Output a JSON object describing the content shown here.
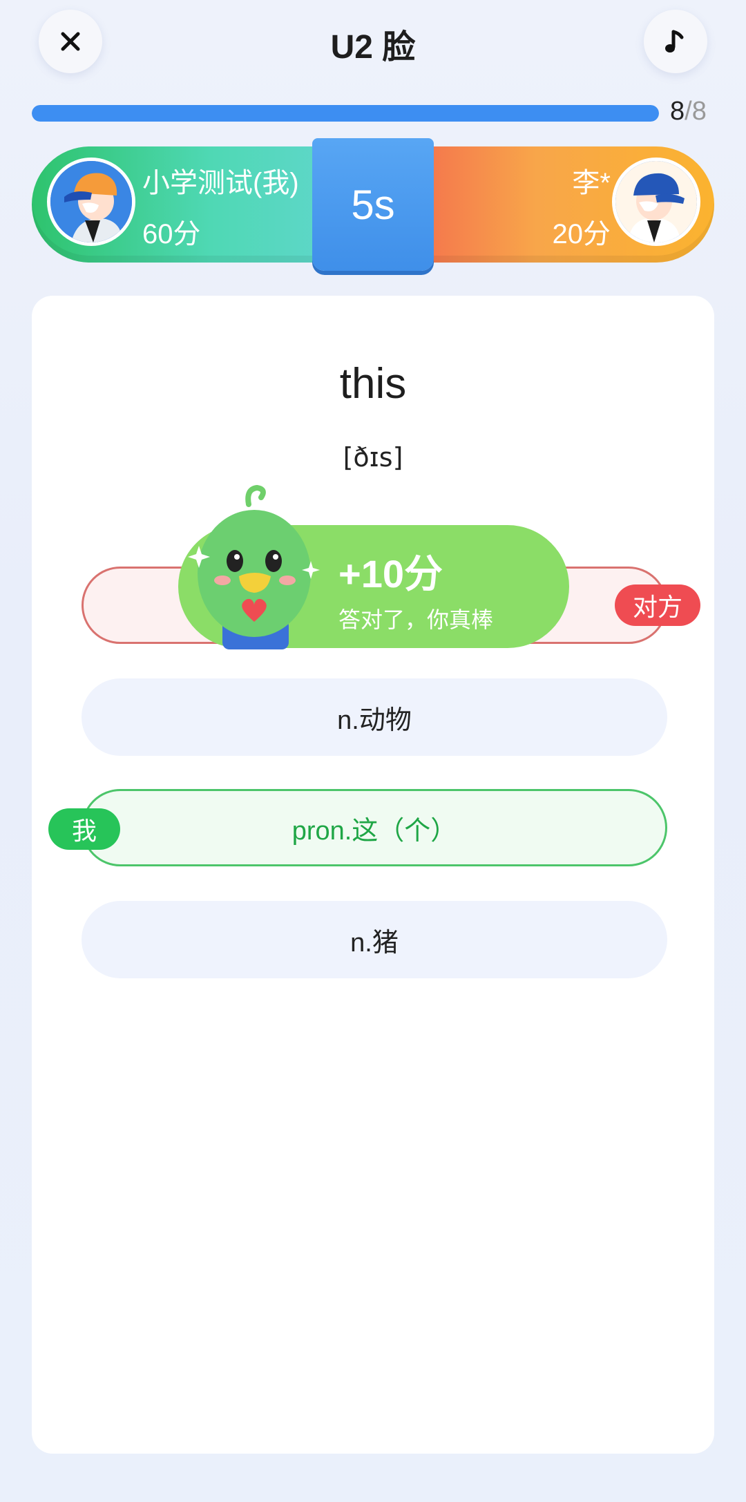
{
  "header": {
    "title": "U2 脸",
    "close_icon": "close-icon",
    "music_icon": "music-note-icon"
  },
  "progress": {
    "current": "8",
    "separator": "/",
    "total": "8",
    "fraction": 1.0
  },
  "battle": {
    "left_player": {
      "name": "小学测试(我)",
      "score": "60分",
      "avatar": "avatar-icon"
    },
    "right_player": {
      "name": "李*",
      "score": "20分",
      "avatar": "avatar-icon"
    },
    "timer": "5s",
    "colors": {
      "left": "#3fd39a",
      "right": "#f8a64a",
      "timer": "#4a9af0"
    }
  },
  "question": {
    "word": "this",
    "phonetic": "[ðɪs]"
  },
  "options": [
    {
      "label": "",
      "state": "wrong",
      "tag": "对方"
    },
    {
      "label": "n.动物",
      "state": "normal"
    },
    {
      "label": "pron.这（个）",
      "state": "correct",
      "tag": "我"
    },
    {
      "label": "n.猪",
      "state": "normal"
    }
  ],
  "toast": {
    "points": "+10分",
    "message": "答对了，你真棒",
    "mascot": "green-bird-mascot-icon"
  },
  "colors": {
    "accent": "#3d8ef2",
    "correct": "#27c459",
    "wrong": "#ef4c52",
    "toast": "#8bdd67"
  }
}
